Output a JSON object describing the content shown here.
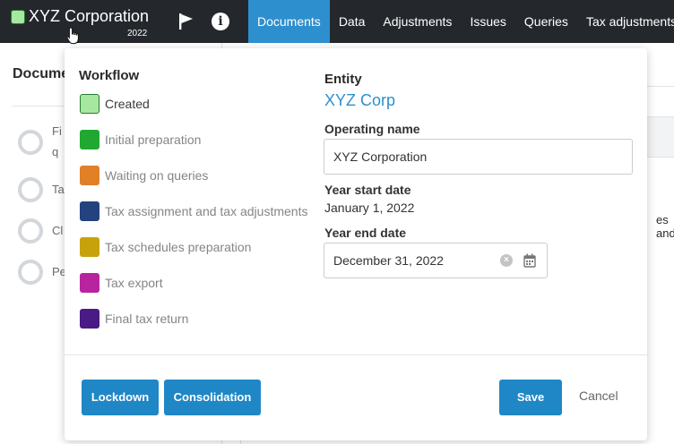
{
  "header": {
    "company_name": "XYZ Corporation",
    "year": "2022",
    "brand_color": "#a6e8a0",
    "icons": [
      "flag-icon",
      "info-icon"
    ],
    "info_glyph": "i",
    "tabs": [
      {
        "label": "Documents",
        "active": true
      },
      {
        "label": "Data",
        "active": false
      },
      {
        "label": "Adjustments",
        "active": false
      },
      {
        "label": "Issues",
        "active": false
      },
      {
        "label": "Queries",
        "active": false
      },
      {
        "label": "Tax adjustments",
        "active": false
      }
    ]
  },
  "background": {
    "title": "Docume",
    "steps": [
      "Fi",
      "q",
      "Ta",
      "Cl",
      "Pe"
    ],
    "fragment": "es and"
  },
  "workflow": {
    "title": "Workflow",
    "stages": [
      {
        "label": "Created",
        "color": "#a6e8a0"
      },
      {
        "label": "Initial preparation",
        "color": "#20a830"
      },
      {
        "label": "Waiting on queries",
        "color": "#e08028"
      },
      {
        "label": "Tax assignment and tax adjustments",
        "color": "#23427f"
      },
      {
        "label": "Tax schedules preparation",
        "color": "#c8a20a"
      },
      {
        "label": "Tax export",
        "color": "#b8239f"
      },
      {
        "label": "Final tax return",
        "color": "#4a1a85"
      }
    ]
  },
  "entity": {
    "label": "Entity",
    "name": "XYZ Corp",
    "operating_name_label": "Operating name",
    "operating_name_value": "XYZ Corporation",
    "year_start_label": "Year start date",
    "year_start_value": "January 1, 2022",
    "year_end_label": "Year end date",
    "year_end_value": "December 31, 2022",
    "clear_glyph": "×"
  },
  "actions": {
    "lockdown": "Lockdown",
    "consolidation": "Consolidation",
    "save": "Save",
    "cancel": "Cancel"
  }
}
